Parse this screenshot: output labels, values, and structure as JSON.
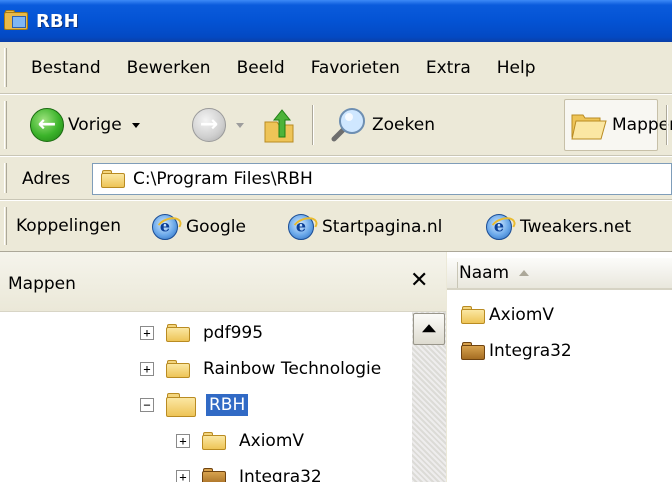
{
  "window": {
    "title": "RBH"
  },
  "menu": {
    "items": [
      "Bestand",
      "Bewerken",
      "Beeld",
      "Favorieten",
      "Extra",
      "Help"
    ]
  },
  "toolbar": {
    "back_label": "Vorige",
    "search_label": "Zoeken",
    "folders_label": "Mappen"
  },
  "address": {
    "label": "Adres",
    "value": "C:\\Program Files\\RBH"
  },
  "links": {
    "label": "Koppelingen",
    "items": [
      "Google",
      "Startpagina.nl",
      "Tweakers.net"
    ]
  },
  "folder_pane": {
    "title": "Mappen",
    "close_glyph": "✕",
    "tree": [
      {
        "name": "pdf995",
        "expander": "+"
      },
      {
        "name": "Rainbow Technologie",
        "expander": "+"
      },
      {
        "name": "RBH",
        "expander": "−",
        "selected": true
      },
      {
        "name": "AxiomV",
        "expander": "+"
      },
      {
        "name": "Integra32",
        "expander": "+"
      }
    ]
  },
  "file_list": {
    "column_name": "Naam",
    "items": [
      {
        "name": "AxiomV",
        "icon": "folder-icon"
      },
      {
        "name": "Integra32",
        "icon": "folder-special-icon"
      }
    ]
  },
  "colors": {
    "title_bar": "#0453d4",
    "selection": "#316ac5",
    "chrome": "#ece9d8"
  }
}
